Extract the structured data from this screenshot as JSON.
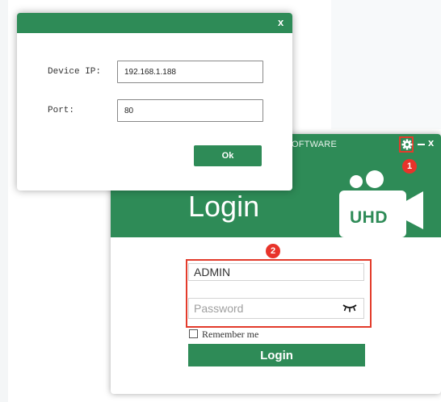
{
  "colors": {
    "brand_green": "#2e8b57",
    "annotation_red": "#e33b2b"
  },
  "device_dialog": {
    "close_icon": "×-close-icon",
    "close_glyph": "x",
    "ip_label": "Device IP:",
    "ip_value": "192.168.1.188",
    "port_label": "Port:",
    "port_value": "80",
    "ok_label": "Ok"
  },
  "login_window": {
    "software_text": "OFTWARE",
    "settings_icon": "gear-icon",
    "close_glyph": "x",
    "title": "Login",
    "logo_text": "UHD",
    "username_value": "ADMIN",
    "password_placeholder": "Password",
    "show_password_icon": "eye-closed-icon",
    "remember_label": "Remember me",
    "remember_checked": false,
    "login_button_label": "Login"
  },
  "annotations": {
    "marker_1": "1",
    "marker_2": "2"
  }
}
